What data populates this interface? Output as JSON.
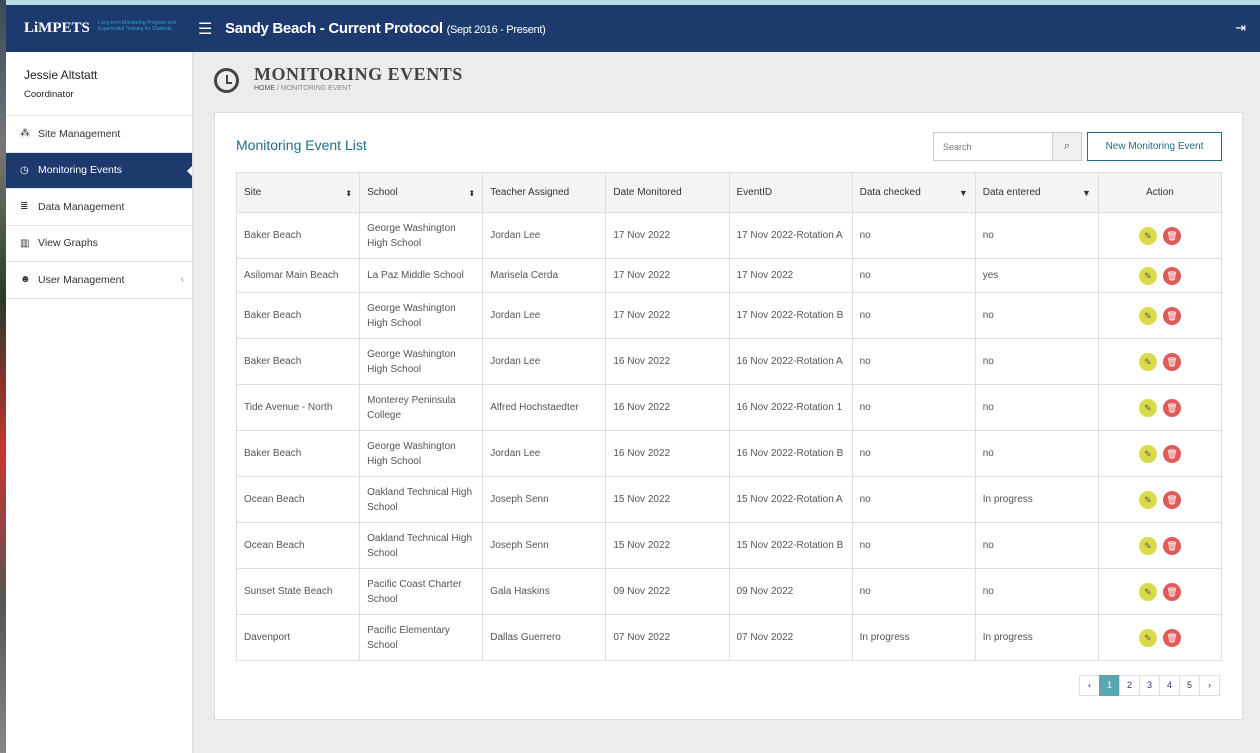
{
  "header": {
    "logo": "LiMPETS",
    "logo_sub": "Long-term Monitoring Program and Experiential Training for Students",
    "title": "Sandy Beach - Current Protocol",
    "title_sub": "(Sept 2016 - Present)"
  },
  "user": {
    "name": "Jessie Altstatt",
    "role": "Coordinator"
  },
  "nav": [
    {
      "label": "Site Management"
    },
    {
      "label": "Monitoring Events"
    },
    {
      "label": "Data Management"
    },
    {
      "label": "View Graphs"
    },
    {
      "label": "User Management"
    }
  ],
  "page": {
    "title": "MONITORING EVENTS",
    "crumb_home": "HOME",
    "crumb_sep": "/",
    "crumb_current": "MONITORING EVENT"
  },
  "panel": {
    "title": "Monitoring Event List",
    "search_placeholder": "Search",
    "new_button": "New Monitoring Event"
  },
  "columns": [
    "Site",
    "School",
    "Teacher Assigned",
    "Date Monitored",
    "EventID",
    "Data checked",
    "Data entered",
    "Action"
  ],
  "rows": [
    [
      "Baker Beach",
      "George Washington High School",
      "Jordan Lee",
      "17 Nov 2022",
      "17 Nov 2022-Rotation A",
      "no",
      "no"
    ],
    [
      "Asilomar Main Beach",
      "La Paz Middle School",
      "Marisela Cerda",
      "17 Nov 2022",
      "17 Nov 2022",
      "no",
      "yes"
    ],
    [
      "Baker Beach",
      "George Washington High School",
      "Jordan Lee",
      "17 Nov 2022",
      "17 Nov 2022-Rotation B",
      "no",
      "no"
    ],
    [
      "Baker Beach",
      "George Washington High School",
      "Jordan Lee",
      "16 Nov 2022",
      "16 Nov 2022-Rotation A",
      "no",
      "no"
    ],
    [
      "Tide Avenue - North",
      "Monterey Peninsula College",
      "Alfred Hochstaedter",
      "16 Nov 2022",
      "16 Nov 2022-Rotation 1",
      "no",
      "no"
    ],
    [
      "Baker Beach",
      "George Washington High School",
      "Jordan Lee",
      "16 Nov 2022",
      "16 Nov 2022-Rotation B",
      "no",
      "no"
    ],
    [
      "Ocean Beach",
      "Oakland Technical High School",
      "Joseph Senn",
      "15 Nov 2022",
      "15 Nov 2022-Rotation A",
      "no",
      "In progress"
    ],
    [
      "Ocean Beach",
      "Oakland Technical High School",
      "Joseph Senn",
      "15 Nov 2022",
      "15 Nov 2022-Rotation B",
      "no",
      "no"
    ],
    [
      "Sunset State Beach",
      "Pacific Coast Charter School",
      "Gala Haskins",
      "09 Nov 2022",
      "09 Nov 2022",
      "no",
      "no"
    ],
    [
      "Davenport",
      "Pacific Elementary School",
      "Dallas Guerrero",
      "07 Nov 2022",
      "07 Nov 2022",
      "In progress",
      "In progress"
    ]
  ],
  "pagination": {
    "prev": "‹",
    "pages": [
      "1",
      "2",
      "3",
      "4",
      "5"
    ],
    "next": "›",
    "current": "1"
  }
}
